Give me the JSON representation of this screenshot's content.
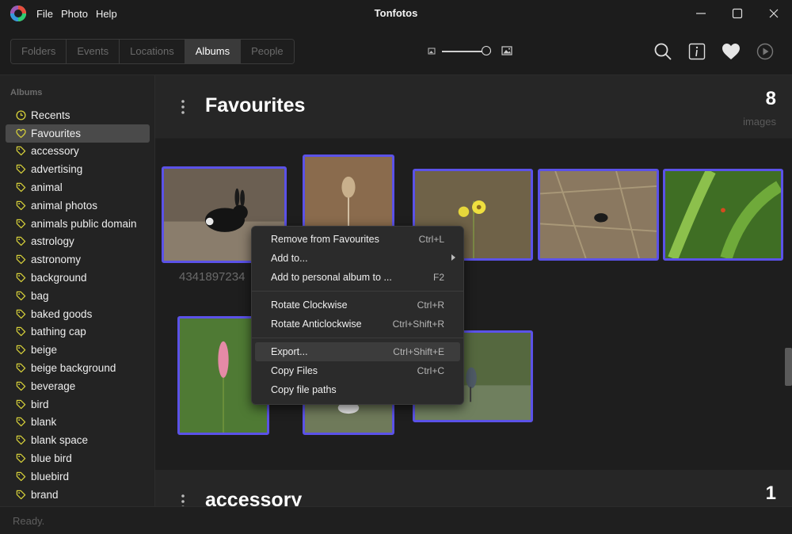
{
  "window": {
    "title": "Tonfotos",
    "menu": [
      "File",
      "Photo",
      "Help"
    ]
  },
  "toolbar": {
    "tabs": [
      {
        "label": "Folders",
        "active": false
      },
      {
        "label": "Events",
        "active": false
      },
      {
        "label": "Locations",
        "active": false
      },
      {
        "label": "Albums",
        "active": true
      },
      {
        "label": "People",
        "active": false
      }
    ],
    "zoom_level": 0.9,
    "icons": [
      "search-icon",
      "info-icon",
      "heart-icon",
      "play-icon"
    ]
  },
  "sidebar": {
    "heading": "Albums",
    "items": [
      {
        "label": "Recents",
        "icon": "clock-icon"
      },
      {
        "label": "Favourites",
        "icon": "heart-icon",
        "selected": true
      },
      {
        "label": "accessory",
        "icon": "tag-icon"
      },
      {
        "label": "advertising",
        "icon": "tag-icon"
      },
      {
        "label": "animal",
        "icon": "tag-icon"
      },
      {
        "label": "animal photos",
        "icon": "tag-icon"
      },
      {
        "label": "animals public domain",
        "icon": "tag-icon"
      },
      {
        "label": "astrology",
        "icon": "tag-icon"
      },
      {
        "label": "astronomy",
        "icon": "tag-icon"
      },
      {
        "label": "background",
        "icon": "tag-icon"
      },
      {
        "label": "bag",
        "icon": "tag-icon"
      },
      {
        "label": "baked goods",
        "icon": "tag-icon"
      },
      {
        "label": "bathing cap",
        "icon": "tag-icon"
      },
      {
        "label": "beige",
        "icon": "tag-icon"
      },
      {
        "label": "beige background",
        "icon": "tag-icon"
      },
      {
        "label": "beverage",
        "icon": "tag-icon"
      },
      {
        "label": "bird",
        "icon": "tag-icon"
      },
      {
        "label": "blank",
        "icon": "tag-icon"
      },
      {
        "label": "blank space",
        "icon": "tag-icon"
      },
      {
        "label": "blue bird",
        "icon": "tag-icon"
      },
      {
        "label": "bluebird",
        "icon": "tag-icon"
      },
      {
        "label": "brand",
        "icon": "tag-icon"
      }
    ]
  },
  "album": {
    "title": "Favourites",
    "count": "8",
    "count_unit": "images",
    "caption": "4341897234"
  },
  "next_album": {
    "title": "accessory",
    "count": "1"
  },
  "context_menu": {
    "items": [
      {
        "label": "Remove from Favourites",
        "shortcut": "Ctrl+L"
      },
      {
        "label": "Add to...",
        "shortcut": ""
      },
      {
        "label": "Add to personal album to ...",
        "shortcut": "F2"
      },
      {
        "label": "Rotate Clockwise",
        "shortcut": "Ctrl+R"
      },
      {
        "label": "Rotate Anticlockwise",
        "shortcut": "Ctrl+Shift+R"
      },
      {
        "label": "Export...",
        "shortcut": "Ctrl+Shift+E",
        "hover": true
      },
      {
        "label": "Copy Files",
        "shortcut": "Ctrl+C"
      },
      {
        "label": "Copy file paths",
        "shortcut": ""
      }
    ]
  },
  "status": {
    "text": "Ready."
  },
  "colors": {
    "selection": "#5b52e8",
    "tag_icon": "#d8d23a",
    "background": "#202020"
  }
}
